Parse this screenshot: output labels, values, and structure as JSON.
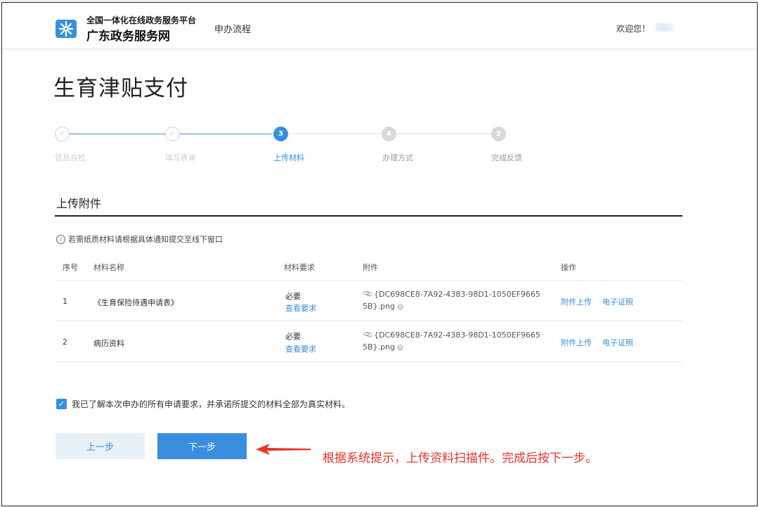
{
  "header": {
    "logo_line1": "全国一体化在线政务服务平台",
    "logo_line2": "广东政务服务网",
    "nav_link": "申办流程",
    "welcome": "欢迎您！",
    "colors": {
      "brand": "#3a8ee0"
    }
  },
  "page_title": "生育津贴支付",
  "steps": [
    {
      "label": "信息自检",
      "state": "done",
      "num": "✓"
    },
    {
      "label": "填写表单",
      "state": "done",
      "num": "✓"
    },
    {
      "label": "上传材料",
      "state": "active",
      "num": "3"
    },
    {
      "label": "办理方式",
      "state": "todo",
      "num": "4"
    },
    {
      "label": "完成反馈",
      "state": "todo",
      "num": "5"
    }
  ],
  "section_title": "上传附件",
  "notice": "若需纸质材料请根据具体通知提交至线下窗口",
  "table": {
    "headers": [
      "序号",
      "材料名称",
      "材料要求",
      "附件",
      "操作"
    ],
    "rows": [
      {
        "no": "1",
        "name": "《生育保险待遇申请表》",
        "req": "必要",
        "req_link": "查看要求",
        "file_line1": "{DC698CE8-7A92-4383-98D1-1050EF9665",
        "file_line2": "5B}.png",
        "action_upload": "附件上传",
        "action_cert": "电子证照"
      },
      {
        "no": "2",
        "name": "病历资料",
        "req": "必要",
        "req_link": "查看要求",
        "file_line1": "{DC698CE8-7A92-4383-98D1-1050EF9665",
        "file_line2": "5B}.png",
        "action_upload": "附件上传",
        "action_cert": "电子证照"
      }
    ]
  },
  "agree_text": "我已了解本次申办的所有申请要求，并承诺所提交的材料全部为真实材料。",
  "buttons": {
    "prev": "上一步",
    "next": "下一步"
  },
  "annotation": "根据系统提示，上传资料扫描件。完成后按下一步。"
}
